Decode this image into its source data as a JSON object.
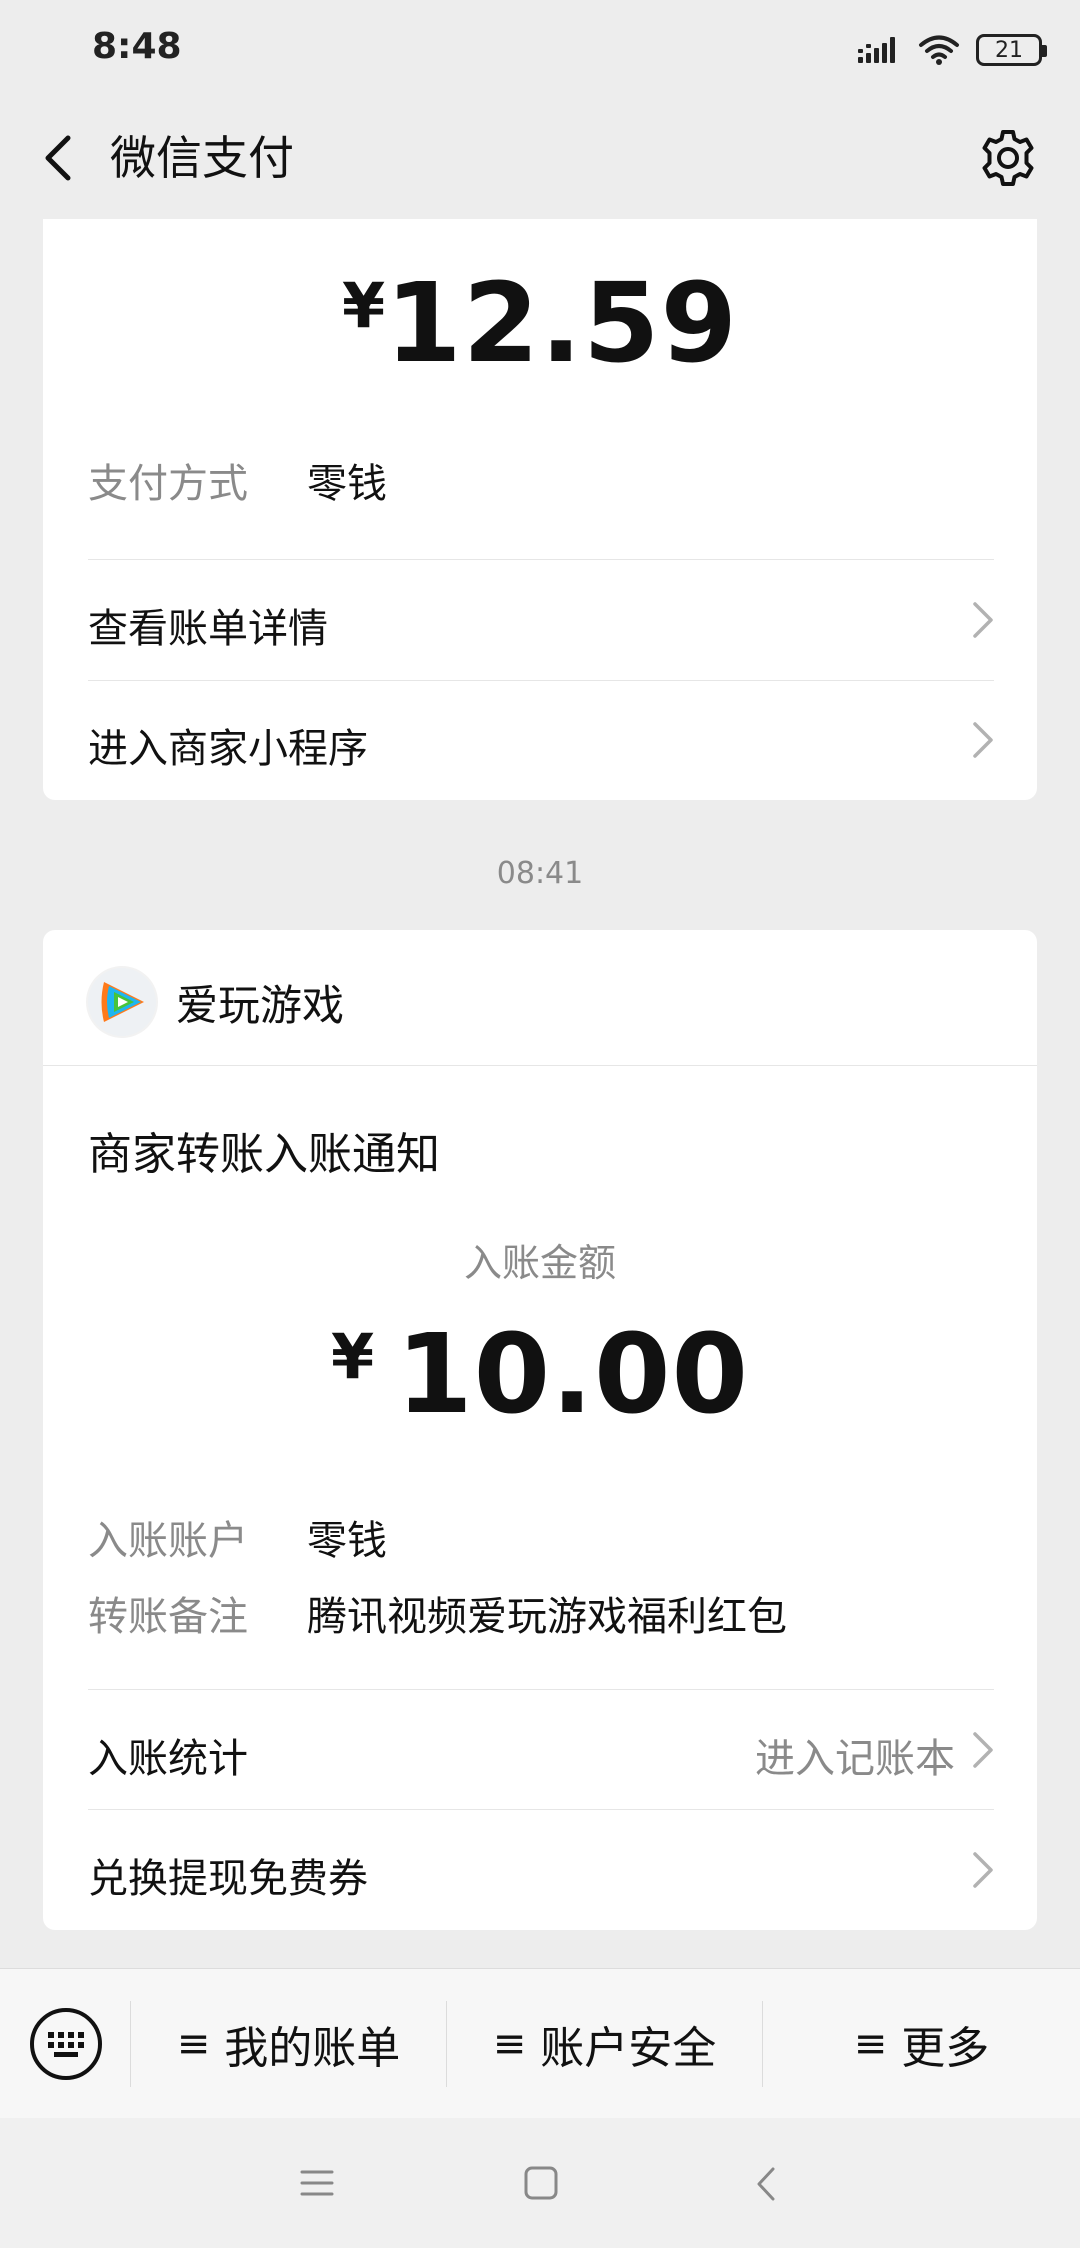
{
  "status_bar": {
    "time": "8:48",
    "battery": "21"
  },
  "header": {
    "title": "微信支付"
  },
  "payment_card": {
    "currency": "¥",
    "amount": "12.59",
    "method_label": "支付方式",
    "method_value": "零钱",
    "rows": [
      {
        "label": "查看账单详情"
      },
      {
        "label": "进入商家小程序"
      }
    ]
  },
  "time_separator": "08:41",
  "notice_card": {
    "merchant_name": "爱玩游戏",
    "title": "商家转账入账通知",
    "amount_label": "入账金额",
    "currency": "¥",
    "amount": "10.00",
    "details": [
      {
        "label": "入账账户",
        "value": "零钱"
      },
      {
        "label": "转账备注",
        "value": "腾讯视频爱玩游戏福利红包"
      }
    ],
    "stats_label": "入账统计",
    "stats_link": "进入记账本",
    "coupon_label": "兑换提现免费券"
  },
  "bottom_menu": {
    "items": [
      {
        "label": "我的账单"
      },
      {
        "label": "账户安全"
      },
      {
        "label": "更多"
      }
    ],
    "burger_glyph": "≡"
  },
  "colors": {
    "background": "#ededed",
    "card": "#ffffff",
    "secondary_text": "#8a8a8a"
  }
}
